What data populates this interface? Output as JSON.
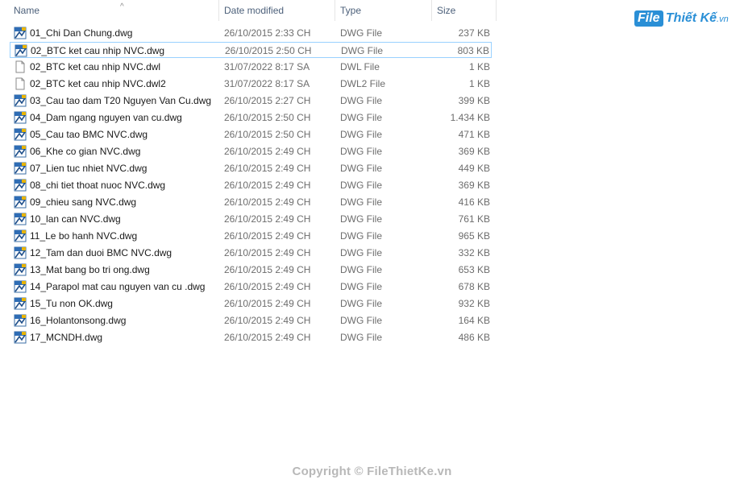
{
  "columns": {
    "name": "Name",
    "date_modified": "Date modified",
    "type": "Type",
    "size": "Size"
  },
  "files": [
    {
      "name": "01_Chi Dan Chung.dwg",
      "date": "26/10/2015 2:33 CH",
      "type": "DWG File",
      "size": "237 KB",
      "icon": "dwg-file-icon"
    },
    {
      "name": "02_BTC ket cau nhip NVC.dwg",
      "date": "26/10/2015 2:50 CH",
      "type": "DWG File",
      "size": "803 KB",
      "icon": "dwg-file-icon",
      "selected": true
    },
    {
      "name": "02_BTC ket cau nhip NVC.dwl",
      "date": "31/07/2022 8:17 SA",
      "type": "DWL File",
      "size": "1 KB",
      "icon": "blank-file-icon"
    },
    {
      "name": "02_BTC ket cau nhip NVC.dwl2",
      "date": "31/07/2022 8:17 SA",
      "type": "DWL2 File",
      "size": "1 KB",
      "icon": "blank-file-icon"
    },
    {
      "name": "03_Cau tao dam T20 Nguyen Van Cu.dwg",
      "date": "26/10/2015 2:27 CH",
      "type": "DWG File",
      "size": "399 KB",
      "icon": "dwg-file-icon"
    },
    {
      "name": "04_Dam ngang nguyen van cu.dwg",
      "date": "26/10/2015 2:50 CH",
      "type": "DWG File",
      "size": "1.434 KB",
      "icon": "dwg-file-icon"
    },
    {
      "name": "05_Cau tao BMC NVC.dwg",
      "date": "26/10/2015 2:50 CH",
      "type": "DWG File",
      "size": "471 KB",
      "icon": "dwg-file-icon"
    },
    {
      "name": "06_Khe co gian NVC.dwg",
      "date": "26/10/2015 2:49 CH",
      "type": "DWG File",
      "size": "369 KB",
      "icon": "dwg-file-icon"
    },
    {
      "name": "07_Lien tuc nhiet NVC.dwg",
      "date": "26/10/2015 2:49 CH",
      "type": "DWG File",
      "size": "449 KB",
      "icon": "dwg-file-icon"
    },
    {
      "name": "08_chi tiet thoat nuoc NVC.dwg",
      "date": "26/10/2015 2:49 CH",
      "type": "DWG File",
      "size": "369 KB",
      "icon": "dwg-file-icon"
    },
    {
      "name": "09_chieu sang NVC.dwg",
      "date": "26/10/2015 2:49 CH",
      "type": "DWG File",
      "size": "416 KB",
      "icon": "dwg-file-icon"
    },
    {
      "name": "10_lan can NVC.dwg",
      "date": "26/10/2015 2:49 CH",
      "type": "DWG File",
      "size": "761 KB",
      "icon": "dwg-file-icon"
    },
    {
      "name": "11_Le bo hanh NVC.dwg",
      "date": "26/10/2015 2:49 CH",
      "type": "DWG File",
      "size": "965 KB",
      "icon": "dwg-file-icon"
    },
    {
      "name": "12_Tam dan duoi BMC NVC.dwg",
      "date": "26/10/2015 2:49 CH",
      "type": "DWG File",
      "size": "332 KB",
      "icon": "dwg-file-icon"
    },
    {
      "name": "13_Mat bang bo tri ong.dwg",
      "date": "26/10/2015 2:49 CH",
      "type": "DWG File",
      "size": "653 KB",
      "icon": "dwg-file-icon"
    },
    {
      "name": "14_Parapol mat cau nguyen van cu .dwg",
      "date": "26/10/2015 2:49 CH",
      "type": "DWG File",
      "size": "678 KB",
      "icon": "dwg-file-icon"
    },
    {
      "name": "15_Tu non OK.dwg",
      "date": "26/10/2015 2:49 CH",
      "type": "DWG File",
      "size": "932 KB",
      "icon": "dwg-file-icon"
    },
    {
      "name": "16_Holantonsong.dwg",
      "date": "26/10/2015 2:49 CH",
      "type": "DWG File",
      "size": "164 KB",
      "icon": "dwg-file-icon"
    },
    {
      "name": "17_MCNDH.dwg",
      "date": "26/10/2015 2:49 CH",
      "type": "DWG File",
      "size": "486 KB",
      "icon": "dwg-file-icon"
    }
  ],
  "watermark": {
    "logo_file": "File",
    "logo_name": "Thiết Kế",
    "logo_tld": ".vn",
    "copyright": "Copyright © FileThietKe.vn"
  }
}
